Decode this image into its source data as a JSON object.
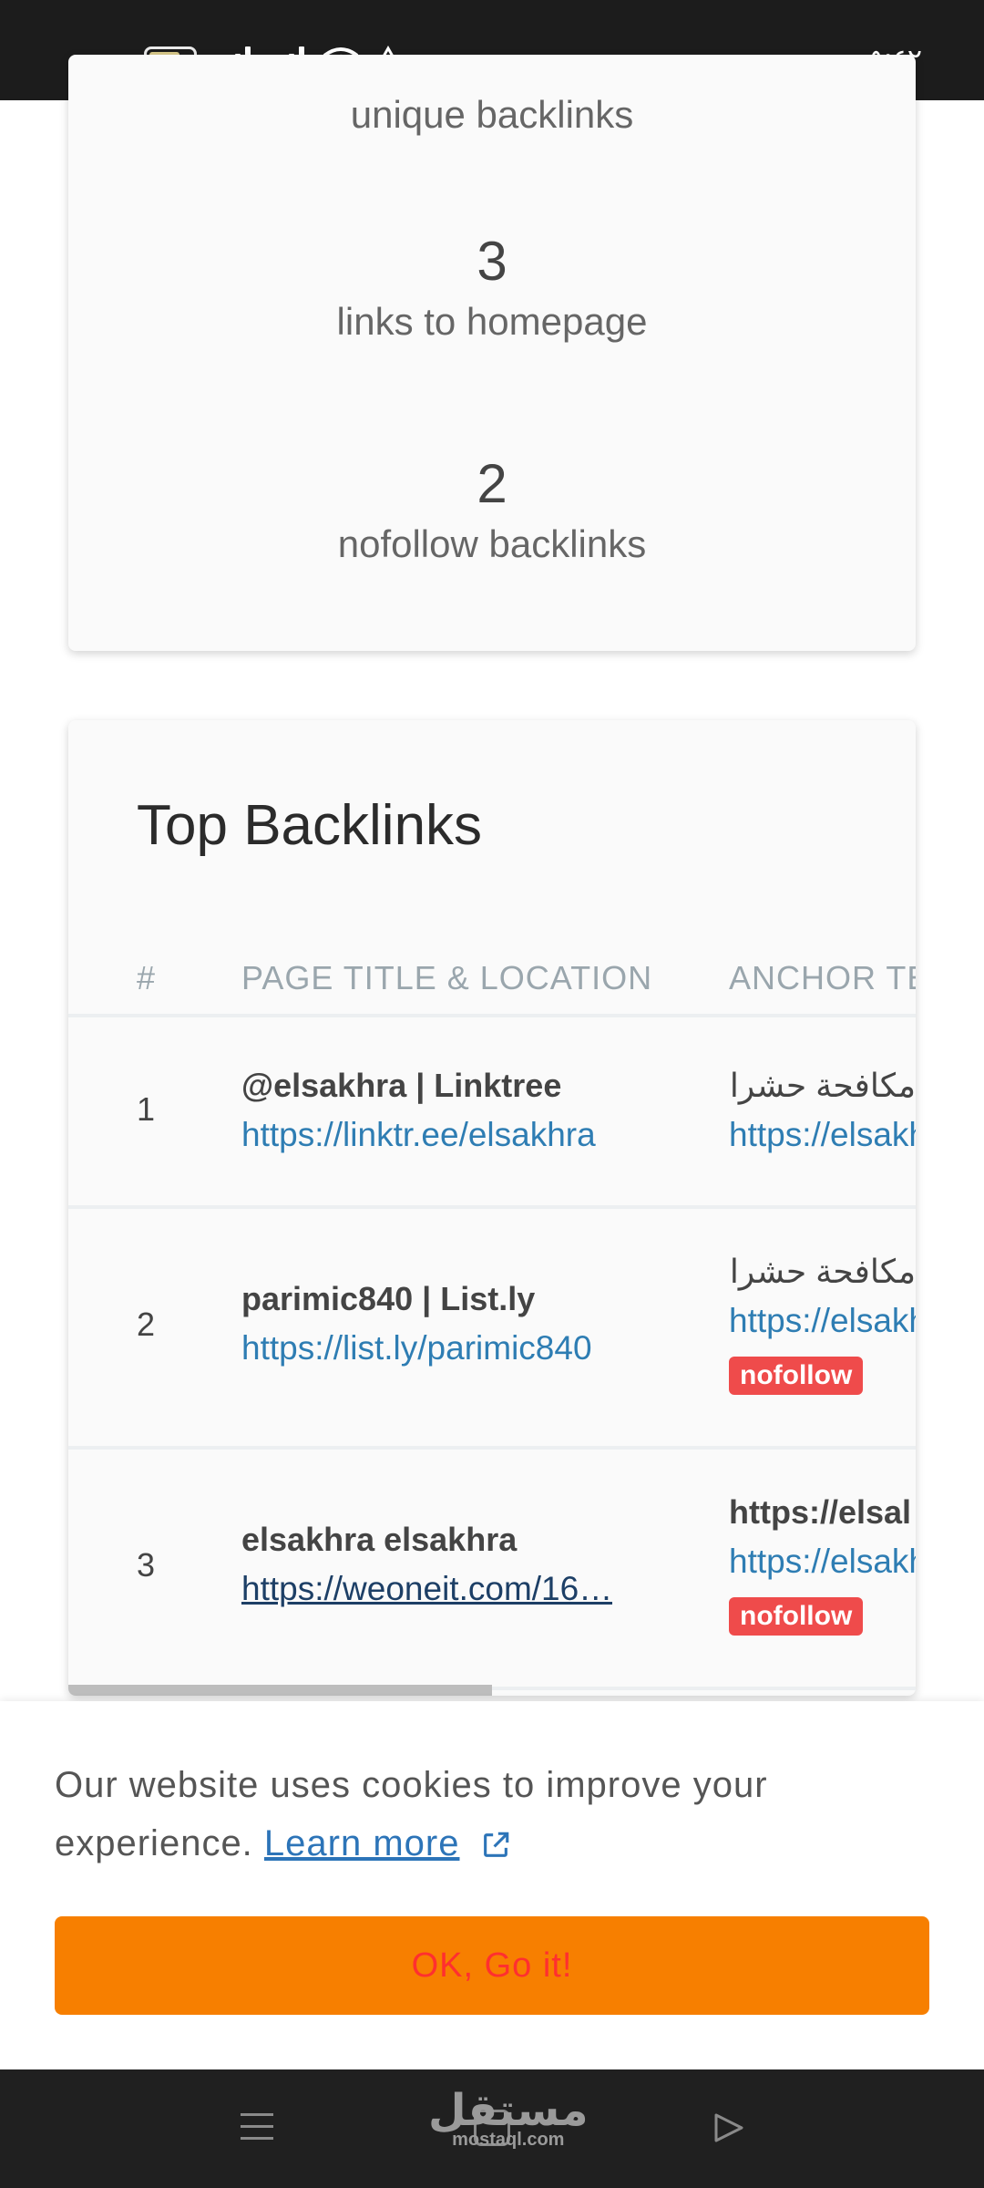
{
  "status_bar": {
    "battery_level": "٧٠",
    "time": "٥:٤٢",
    "icons": [
      "battery-icon",
      "signal-icon",
      "signal-icon",
      "wifi-icon",
      "data-saver-icon"
    ]
  },
  "stats": {
    "partial_label": "unique backlinks",
    "items": [
      {
        "number": "3",
        "label": "links to homepage"
      },
      {
        "number": "2",
        "label": "nofollow backlinks"
      }
    ]
  },
  "top_backlinks": {
    "title": "Top Backlinks",
    "columns": [
      "#",
      "PAGE TITLE & LOCATION",
      "ANCHOR TE"
    ],
    "rows": [
      {
        "num": "1",
        "page_title": "@elsakhra | Linktree",
        "page_url": "https://linktr.ee/elsakhra",
        "anchor_text": "مكافحة حشرات عفش في مصر",
        "anchor_url": "https://elsakhra",
        "badge": ""
      },
      {
        "num": "2",
        "page_title": "parimic840 | List.ly",
        "page_url": "https://list.ly/parimic840",
        "anchor_text": "مكافحة حشرات عفش في مصر",
        "anchor_url": "https://elsakhra",
        "badge": "nofollow"
      },
      {
        "num": "3",
        "page_title": "elsakhra elsakhra",
        "page_url": "https://weoneit.com/16…",
        "anchor_text": "https://elsal",
        "anchor_url": "https://elsakhra",
        "badge": "nofollow"
      }
    ]
  },
  "cookie": {
    "text": "Our website uses cookies to improve your experience.",
    "learn_more": "Learn more",
    "button": "OK, Go it!"
  },
  "nav": {
    "watermark_ar": "مستقل",
    "watermark_en": "mostaql.com"
  },
  "colors": {
    "accent_orange": "#f77f00",
    "link_blue": "#2e7db3",
    "badge_red": "#ef4b4b"
  }
}
